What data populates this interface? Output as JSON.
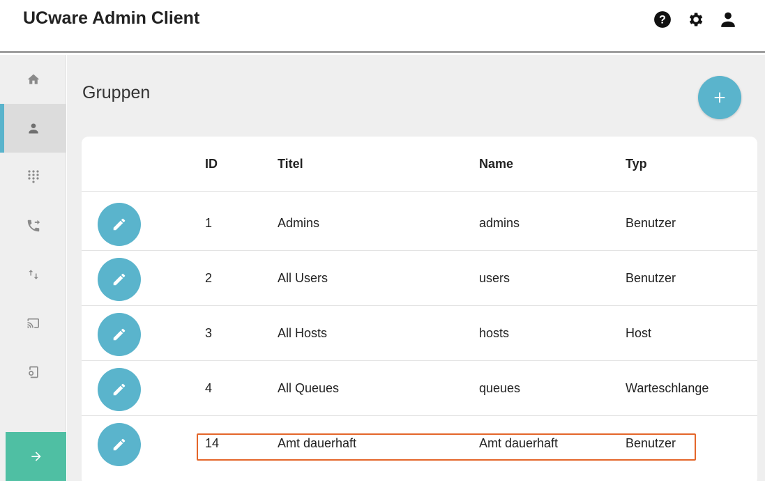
{
  "app": {
    "title": "UCware Admin Client"
  },
  "header": {
    "icons": [
      "help-icon",
      "settings-gear-icon",
      "account-icon"
    ]
  },
  "sidebar": {
    "items": [
      {
        "icon": "home-icon"
      },
      {
        "icon": "person-icon",
        "active": true
      },
      {
        "icon": "dialpad-icon"
      },
      {
        "icon": "phone-forward-icon"
      },
      {
        "icon": "transfer-arrows-icon"
      },
      {
        "icon": "cast-icon"
      },
      {
        "icon": "settings-device-icon"
      }
    ],
    "expand_icon": "arrow-right-icon"
  },
  "page": {
    "title": "Gruppen"
  },
  "table": {
    "columns": [
      "ID",
      "Titel",
      "Name",
      "Typ"
    ],
    "rows": [
      {
        "id": "1",
        "titel": "Admins",
        "name": "admins",
        "typ": "Benutzer"
      },
      {
        "id": "2",
        "titel": "All Users",
        "name": "users",
        "typ": "Benutzer"
      },
      {
        "id": "3",
        "titel": "All Hosts",
        "name": "hosts",
        "typ": "Host"
      },
      {
        "id": "4",
        "titel": "All Queues",
        "name": "queues",
        "typ": "Warteschlange"
      },
      {
        "id": "14",
        "titel": "Amt dauerhaft",
        "name": "Amt dauerhaft",
        "typ": "Benutzer",
        "highlighted": true
      }
    ]
  },
  "colors": {
    "accent": "#5ab4cc",
    "expand": "#4fbfa3",
    "highlight": "#e4662a"
  }
}
